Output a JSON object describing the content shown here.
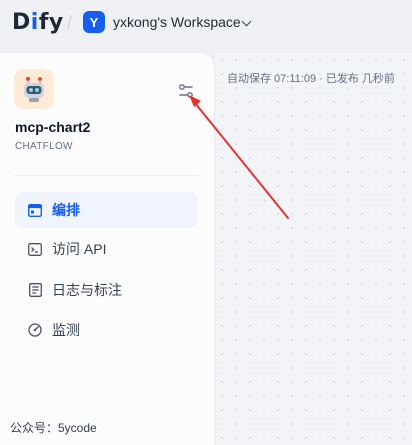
{
  "header": {
    "logo_prefix": "D",
    "logo_i": "i",
    "logo_suffix": "fy",
    "workspace_initial": "Y",
    "workspace_name": "yxkong's Workspace"
  },
  "app": {
    "name": "mcp-chart2",
    "type": "CHATFLOW",
    "icon": "robot-icon"
  },
  "nav": [
    {
      "label": "编排",
      "icon": "layout-icon",
      "active": true
    },
    {
      "label": "访问 API",
      "icon": "terminal-icon",
      "active": false
    },
    {
      "label": "日志与标注",
      "icon": "file-list-icon",
      "active": false
    },
    {
      "label": "监测",
      "icon": "gauge-icon",
      "active": false
    }
  ],
  "footer_text": "公众号：5ycode",
  "canvas": {
    "status": "自动保存 07:11:09 · 已发布 几秒前"
  },
  "colors": {
    "accent": "#155eef",
    "active_bg": "#eff4ff",
    "annotation_arrow": "#e5322d"
  }
}
